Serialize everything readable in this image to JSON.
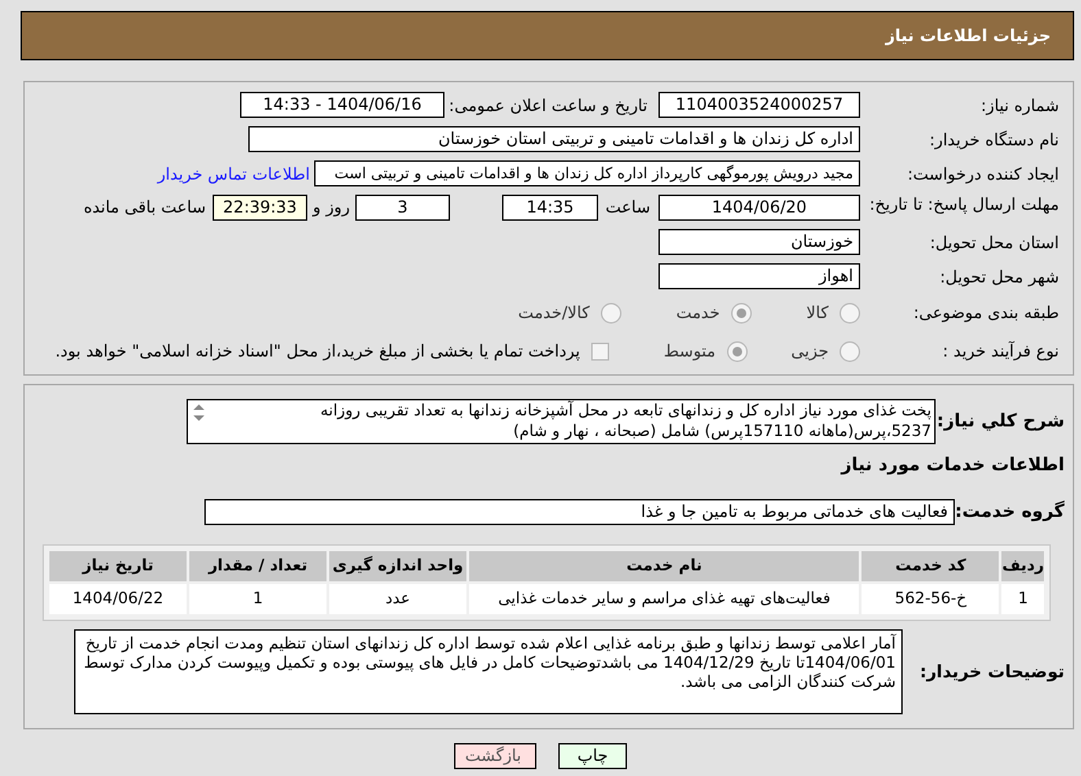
{
  "header": {
    "title": "جزئیات اطلاعات نیاز"
  },
  "need_number": {
    "label": "شماره نیاز:",
    "value": "1104003524000257"
  },
  "announce": {
    "label": "تاریخ و ساعت اعلان عمومی:",
    "value": "1404/06/16 - 14:33"
  },
  "buyer": {
    "label": "نام دستگاه خریدار:",
    "value": "اداره کل زندان ها و اقدامات تامینی و تربیتی استان خوزستان"
  },
  "requester": {
    "label": "ایجاد کننده درخواست:",
    "value": "مجید درویش پورموگهی کارپرداز اداره کل زندان ها و اقدامات تامینی و تربیتی است",
    "link": "اطلاعات تماس خریدار"
  },
  "deadline": {
    "label": "مهلت ارسال پاسخ: تا تاریخ:",
    "date": "1404/06/20",
    "time_label": "ساعت",
    "time": "14:35",
    "days": "3",
    "days_label": "روز و",
    "remaining": "22:39:33",
    "remaining_label": "ساعت باقی مانده"
  },
  "province": {
    "label": "استان محل تحویل:",
    "value": "خوزستان"
  },
  "city": {
    "label": "شهر محل تحویل:",
    "value": "اهواز"
  },
  "category": {
    "label": "طبقه بندی موضوعی:",
    "options": [
      {
        "label": "کالا",
        "selected": false
      },
      {
        "label": "خدمت",
        "selected": true
      },
      {
        "label": "کالا/خدمت",
        "selected": false
      }
    ]
  },
  "process": {
    "label": "نوع فرآیند خرید :",
    "options": [
      {
        "label": "جزیی",
        "selected": false
      },
      {
        "label": "متوسط",
        "selected": true
      }
    ],
    "payment": {
      "label": "پرداخت تمام یا بخشی از مبلغ خرید،از محل \"اسناد خزانه اسلامی\" خواهد بود.",
      "checked": false
    }
  },
  "description": {
    "label": "شرح کلي نياز:",
    "value": "پخت غذای مورد نیاز اداره کل و زندانهای تابعه در محل آشپزخانه زندانها به تعداد تقریبی روزانه 5237،پرس(ماهانه 157110پرس)  شامل (صبحانه ، نهار و شام)"
  },
  "services": {
    "title": "اطلاعات خدمات مورد نياز"
  },
  "service_group": {
    "label": "گروه خدمت:",
    "value": "فعالیت های خدماتی مربوط به تامین جا و غذا"
  },
  "table": {
    "columns": [
      "ردیف",
      "کد خدمت",
      "نام خدمت",
      "واحد اندازه گیری",
      "تعداد / مقدار",
      "تاریخ نیاز"
    ],
    "rows": [
      [
        "1",
        "خ-56-562",
        "فعالیت‌های تهیه غذای مراسم و سایر خدمات غذایی",
        "عدد",
        "1",
        "1404/06/22"
      ]
    ]
  },
  "notes": {
    "label": "توضیحات خریدار:",
    "value": "آمار اعلامی توسط زندانها و طبق برنامه غذایی اعلام شده توسط اداره کل زندانهای استان تنظیم ومدت انجام خدمت از تاریخ 1404/06/01تا تاریخ 1404/12/29 می باشدتوضیحات کامل در فایل های پیوستی بوده و تکمیل وپیوست کردن مدارک توسط شرکت کنندگان الزامی می باشد."
  },
  "buttons": [
    {
      "label": "چاپ",
      "kind": "print"
    },
    {
      "label": "بازگشت",
      "kind": "back"
    }
  ]
}
